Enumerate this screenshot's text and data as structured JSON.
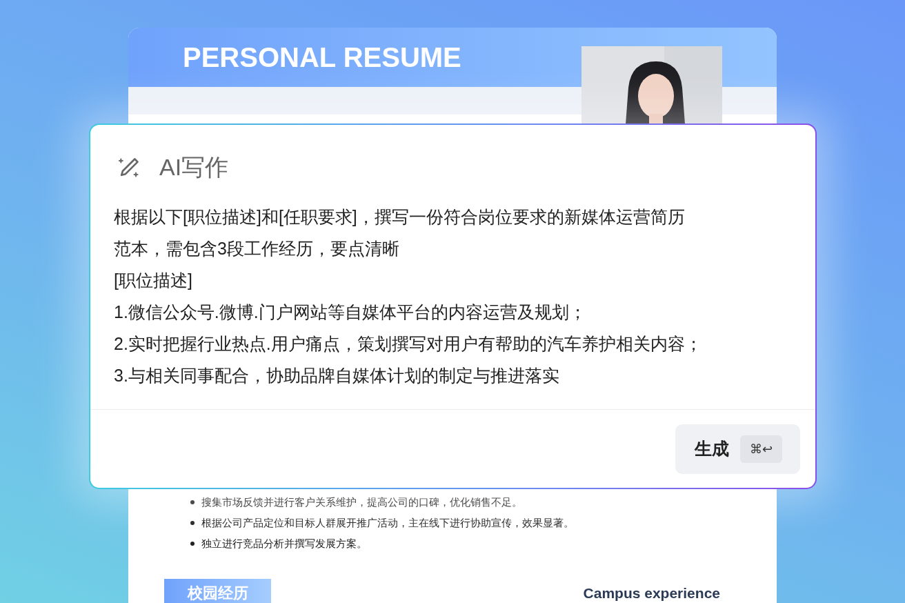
{
  "resume": {
    "header_title": "PERSONAL RESUME",
    "bullets": [
      "搜集市场反馈并进行客户关系维护，提高公司的口碑，优化销售不足。",
      "根据公司产品定位和目标人群展开推广活动，主在线下进行协助宣传，效果显著。",
      "独立进行竞品分析并撰写发展方案。"
    ],
    "section": {
      "title": "校园经历",
      "subtitle": "Campus experience"
    }
  },
  "dialog": {
    "title": "AI写作",
    "prompt_lines": [
      "根据以下[职位描述]和[任职要求]，撰写一份符合岗位要求的新媒体运营简历",
      "范本，需包含3段工作经历，要点清晰",
      "[职位描述]",
      "1.微信公众号.微博.门户网站等自媒体平台的内容运营及规划；",
      "2.实时把握行业热点.用户痛点，策划撰写对用户有帮助的汽车养护相关内容；",
      "3.与相关同事配合，协助品牌自媒体计划的制定与推进落实"
    ],
    "generate_button": {
      "label": "生成",
      "shortcut": "⌘↩"
    }
  }
}
